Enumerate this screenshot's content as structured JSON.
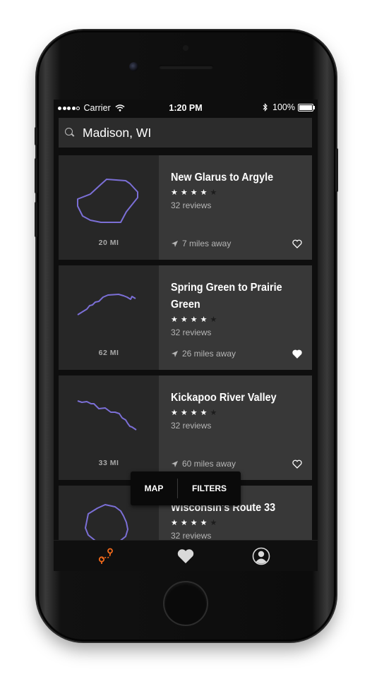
{
  "status_bar": {
    "carrier": "Carrier",
    "time": "1:20 PM",
    "battery": "100%"
  },
  "search": {
    "value": "Madison, WI",
    "icon": "search-icon"
  },
  "routes": [
    {
      "title": "New Glarus to Argyle",
      "rating": 4,
      "reviews": "32 reviews",
      "distance_away": "7 miles away",
      "route_length": "20 MI",
      "favorited": false
    },
    {
      "title": "Spring Green to Prairie Green",
      "rating": 4,
      "reviews": "32 reviews",
      "distance_away": "26 miles away",
      "route_length": "62 MI",
      "favorited": true
    },
    {
      "title": "Kickapoo River Valley",
      "rating": 4,
      "reviews": "32 reviews",
      "distance_away": "60 miles away",
      "route_length": "33 MI",
      "favorited": false
    },
    {
      "title": "Wisconsin's Route 33",
      "rating": 4,
      "reviews": "32 reviews",
      "distance_away": "",
      "route_length": "",
      "favorited": false
    }
  ],
  "segmented_control": {
    "map_label": "MAP",
    "filters_label": "FILTERS"
  },
  "tab_bar": {
    "tabs": [
      {
        "icon": "route-icon",
        "active": true
      },
      {
        "icon": "heart-icon",
        "active": false
      },
      {
        "icon": "profile-icon",
        "active": false
      }
    ]
  },
  "colors": {
    "accent": "#f26a1b",
    "route_line": "#7b6fd6",
    "card_bg": "#383838",
    "map_bg": "#272727"
  }
}
